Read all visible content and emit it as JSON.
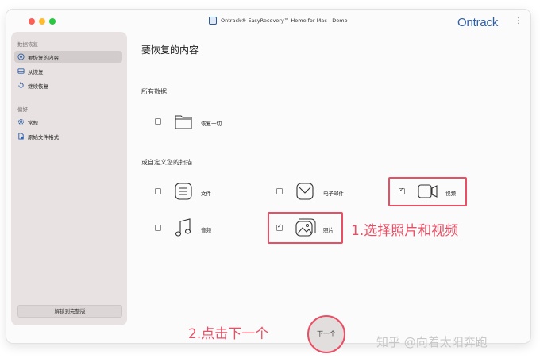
{
  "window": {
    "title": "Ontrack® EasyRecovery™ Home for Mac - Demo",
    "brand": "Ontrack",
    "more_icon": "⋮"
  },
  "sidebar": {
    "section_recovery": "数据恢复",
    "items": [
      {
        "label": "要恢复的内容",
        "icon": "target-icon",
        "active": true
      },
      {
        "label": "从恢复",
        "icon": "drive-icon",
        "active": false
      },
      {
        "label": "继续恢复",
        "icon": "resume-icon",
        "active": false
      }
    ],
    "section_prefs": "偏好",
    "pref_items": [
      {
        "label": "常规",
        "icon": "gear-icon"
      },
      {
        "label": "原始文件格式",
        "icon": "file-format-icon"
      }
    ],
    "unlock_label": "解锁到完整版"
  },
  "main": {
    "title": "要恢复的内容",
    "all_data_label": "所有数据",
    "recover_all_label": "恢复一切",
    "custom_label": "或自定义您的扫描",
    "options": [
      {
        "label": "文件",
        "checked": false,
        "icon": "document-icon"
      },
      {
        "label": "电子邮件",
        "checked": false,
        "icon": "email-icon"
      },
      {
        "label": "视频",
        "checked": true,
        "icon": "video-icon"
      },
      {
        "label": "音频",
        "checked": false,
        "icon": "music-icon"
      },
      {
        "label": "照片",
        "checked": true,
        "icon": "photo-icon"
      }
    ],
    "next_label": "下一个"
  },
  "annotations": {
    "step1": "1.选择照片和视频",
    "step2": "2.点击下一个",
    "accent_color": "#e94f64"
  },
  "watermark": "知乎 @向着太阳奔跑"
}
